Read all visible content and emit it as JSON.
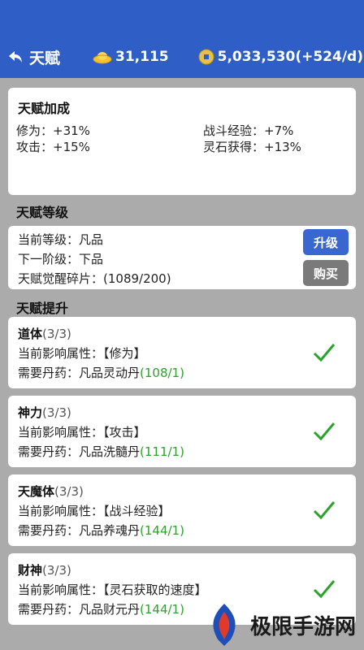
{
  "header": {
    "back_label": "天赋",
    "gold_amount": "31,115",
    "coin_amount": "5,033,530(+524/d)"
  },
  "bonus": {
    "title": "天赋加成",
    "items": [
      "修为：+31%",
      "攻击：+15%",
      "战斗经验：+7%",
      "灵石获得：+13%"
    ]
  },
  "level": {
    "section_title": "天赋等级",
    "current": "当前等级：凡品",
    "next": "下一阶级：下品",
    "fragments": "天赋觉醒碎片：(1089/200)",
    "upgrade_label": "升级",
    "buy_label": "购买"
  },
  "talents_section_title": "天赋提升",
  "talents": [
    {
      "name": "道体",
      "count": "(3/3)",
      "attr": "当前影响属性：【修为】",
      "need": "需要丹药：凡品灵动丹",
      "qty": "(108/1)"
    },
    {
      "name": "神力",
      "count": "(3/3)",
      "attr": "当前影响属性：【攻击】",
      "need": "需要丹药：凡品洗髓丹",
      "qty": "(111/1)"
    },
    {
      "name": "天魔体",
      "count": "(3/3)",
      "attr": "当前影响属性：【战斗经验】",
      "need": "需要丹药：凡品养魂丹",
      "qty": "(144/1)"
    },
    {
      "name": "财神",
      "count": "(3/3)",
      "attr": "当前影响属性：【灵石获取的速度】",
      "need": "需要丹药：凡品财元丹",
      "qty": "(144/1)"
    }
  ],
  "watermark": "极限手游网",
  "colors": {
    "header_bg": "#2f5fc6",
    "upgrade_button": "#3a67cf",
    "buy_button": "#7a7a7a",
    "check": "#2aa32a",
    "page_bg": "#ababab"
  },
  "icons": {
    "back": "back-arrow-icon",
    "gold": "gold-ingot-icon",
    "coin": "spirit-coin-icon",
    "done": "check-icon"
  }
}
